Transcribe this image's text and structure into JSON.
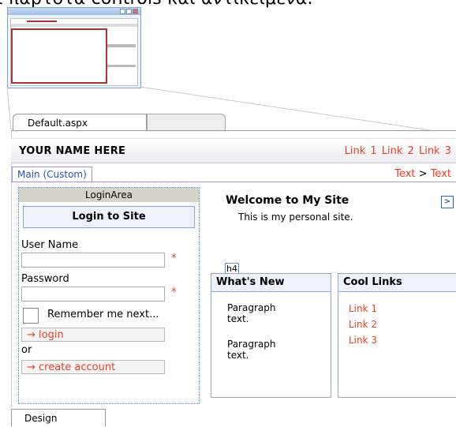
{
  "caption": "ι παρτοτα controls και αντικείμενα.",
  "tabs": {
    "active": "Default.aspx",
    "inactive": ""
  },
  "header": {
    "site_title": "YOUR NAME HERE",
    "links": [
      "Link 1",
      "Link 2",
      "Link 3"
    ]
  },
  "content_placeholder": {
    "label": "Main (Custom)"
  },
  "breadcrumb": {
    "item1": "Text",
    "separator": ">",
    "item2": "Text"
  },
  "arrow_icon": ">",
  "login": {
    "area_label": "LoginArea",
    "title": "Login to Site",
    "username_label": "User Name",
    "password_label": "Password",
    "required_mark": "*",
    "remember_label": "Remember me next...",
    "login_button": "→ login",
    "or_label": "or",
    "create_button": "→ create account"
  },
  "welcome": {
    "title": "Welcome to My Site",
    "subtitle": "This is my personal site."
  },
  "h4_tag": "h4",
  "whats_new": {
    "heading": "What's New",
    "para1": "Paragraph text.",
    "para2": "Paragraph text."
  },
  "cool_links": {
    "heading": "Cool Links",
    "links": [
      "Link 1",
      "Link 2",
      "Link 3"
    ]
  },
  "bottom_tab": "Design",
  "colors": {
    "link": "#e8401f",
    "accent_blue": "#2455b8",
    "thumb_highlight": "#aa3333"
  }
}
